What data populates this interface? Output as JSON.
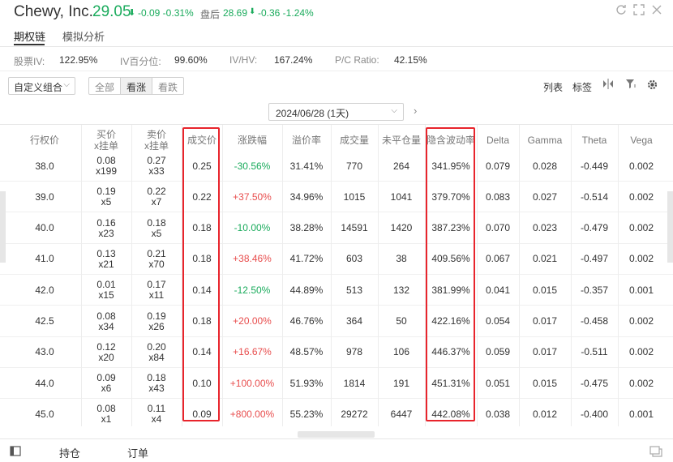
{
  "header": {
    "company": "Chewy, Inc.",
    "price": "29.05",
    "price_arrow": "⬇",
    "change": "-0.09 -0.31%",
    "after_hours_label": "盘后",
    "after_hours_price": "28.69",
    "after_hours_arrow": "⬇",
    "after_hours_change": "-0.36 -1.24%",
    "window_icons": [
      "refresh-icon",
      "expand-icon",
      "close-icon"
    ]
  },
  "tabs": [
    {
      "label": "期权链",
      "active": true
    },
    {
      "label": "模拟分析",
      "active": false
    }
  ],
  "stats": [
    {
      "key": "股票IV:",
      "value": "122.95%"
    },
    {
      "key": "IV百分位:",
      "value": "99.60%"
    },
    {
      "key": "IV/HV:",
      "value": "167.24%"
    },
    {
      "key": "P/C Ratio:",
      "value": "42.15%"
    }
  ],
  "toolbar": {
    "combo": "自定义组合",
    "segments": [
      "全部",
      "看涨",
      "看跌"
    ],
    "active_segment": "看涨",
    "list_label": "列表",
    "tag_label": "标签"
  },
  "expiry": {
    "value": "2024/06/28 (1天)"
  },
  "table": {
    "headers": [
      "行权价",
      "买价\nx挂单",
      "卖价\nx挂单",
      "成交价",
      "涨跌幅",
      "溢价率",
      "成交量",
      "未平仓量",
      "隐含波动率",
      "Delta",
      "Gamma",
      "Theta",
      "Vega"
    ],
    "rows": [
      {
        "strike": "38.0",
        "bid": "0.08",
        "bid_size": "x199",
        "ask": "0.27",
        "ask_size": "x33",
        "last": "0.25",
        "change": "-30.56%",
        "dir": "dn",
        "premium": "31.41%",
        "volume": "770",
        "oi": "264",
        "iv": "341.95%",
        "delta": "0.079",
        "gamma": "0.028",
        "theta": "-0.449",
        "vega": "0.002"
      },
      {
        "strike": "39.0",
        "bid": "0.19",
        "bid_size": "x5",
        "ask": "0.22",
        "ask_size": "x7",
        "last": "0.22",
        "change": "+37.50%",
        "dir": "up",
        "premium": "34.96%",
        "volume": "1015",
        "oi": "1041",
        "iv": "379.70%",
        "delta": "0.083",
        "gamma": "0.027",
        "theta": "-0.514",
        "vega": "0.002"
      },
      {
        "strike": "40.0",
        "bid": "0.16",
        "bid_size": "x23",
        "ask": "0.18",
        "ask_size": "x5",
        "last": "0.18",
        "change": "-10.00%",
        "dir": "dn",
        "premium": "38.28%",
        "volume": "14591",
        "oi": "1420",
        "iv": "387.23%",
        "delta": "0.070",
        "gamma": "0.023",
        "theta": "-0.479",
        "vega": "0.002"
      },
      {
        "strike": "41.0",
        "bid": "0.13",
        "bid_size": "x21",
        "ask": "0.21",
        "ask_size": "x70",
        "last": "0.18",
        "change": "+38.46%",
        "dir": "up",
        "premium": "41.72%",
        "volume": "603",
        "oi": "38",
        "iv": "409.56%",
        "delta": "0.067",
        "gamma": "0.021",
        "theta": "-0.497",
        "vega": "0.002"
      },
      {
        "strike": "42.0",
        "bid": "0.01",
        "bid_size": "x15",
        "ask": "0.17",
        "ask_size": "x11",
        "last": "0.14",
        "change": "-12.50%",
        "dir": "dn",
        "premium": "44.89%",
        "volume": "513",
        "oi": "132",
        "iv": "381.99%",
        "delta": "0.041",
        "gamma": "0.015",
        "theta": "-0.357",
        "vega": "0.001"
      },
      {
        "strike": "42.5",
        "bid": "0.08",
        "bid_size": "x34",
        "ask": "0.19",
        "ask_size": "x26",
        "last": "0.18",
        "change": "+20.00%",
        "dir": "up",
        "premium": "46.76%",
        "volume": "364",
        "oi": "50",
        "iv": "422.16%",
        "delta": "0.054",
        "gamma": "0.017",
        "theta": "-0.458",
        "vega": "0.002"
      },
      {
        "strike": "43.0",
        "bid": "0.12",
        "bid_size": "x20",
        "ask": "0.20",
        "ask_size": "x84",
        "last": "0.14",
        "change": "+16.67%",
        "dir": "up",
        "premium": "48.57%",
        "volume": "978",
        "oi": "106",
        "iv": "446.37%",
        "delta": "0.059",
        "gamma": "0.017",
        "theta": "-0.511",
        "vega": "0.002"
      },
      {
        "strike": "44.0",
        "bid": "0.09",
        "bid_size": "x6",
        "ask": "0.18",
        "ask_size": "x43",
        "last": "0.10",
        "change": "+100.00%",
        "dir": "up",
        "premium": "51.93%",
        "volume": "1814",
        "oi": "191",
        "iv": "451.31%",
        "delta": "0.051",
        "gamma": "0.015",
        "theta": "-0.475",
        "vega": "0.002"
      },
      {
        "strike": "45.0",
        "bid": "0.08",
        "bid_size": "x1",
        "ask": "0.11",
        "ask_size": "x4",
        "last": "0.09",
        "change": "+800.00%",
        "dir": "up",
        "premium": "55.23%",
        "volume": "29272",
        "oi": "6447",
        "iv": "442.08%",
        "delta": "0.038",
        "gamma": "0.012",
        "theta": "-0.400",
        "vega": "0.001"
      }
    ]
  },
  "footer": {
    "positions": "持仓",
    "orders": "订单"
  },
  "colors": {
    "down": "#1aab5c",
    "up": "#e84d4d",
    "highlight": "#e8242c"
  }
}
